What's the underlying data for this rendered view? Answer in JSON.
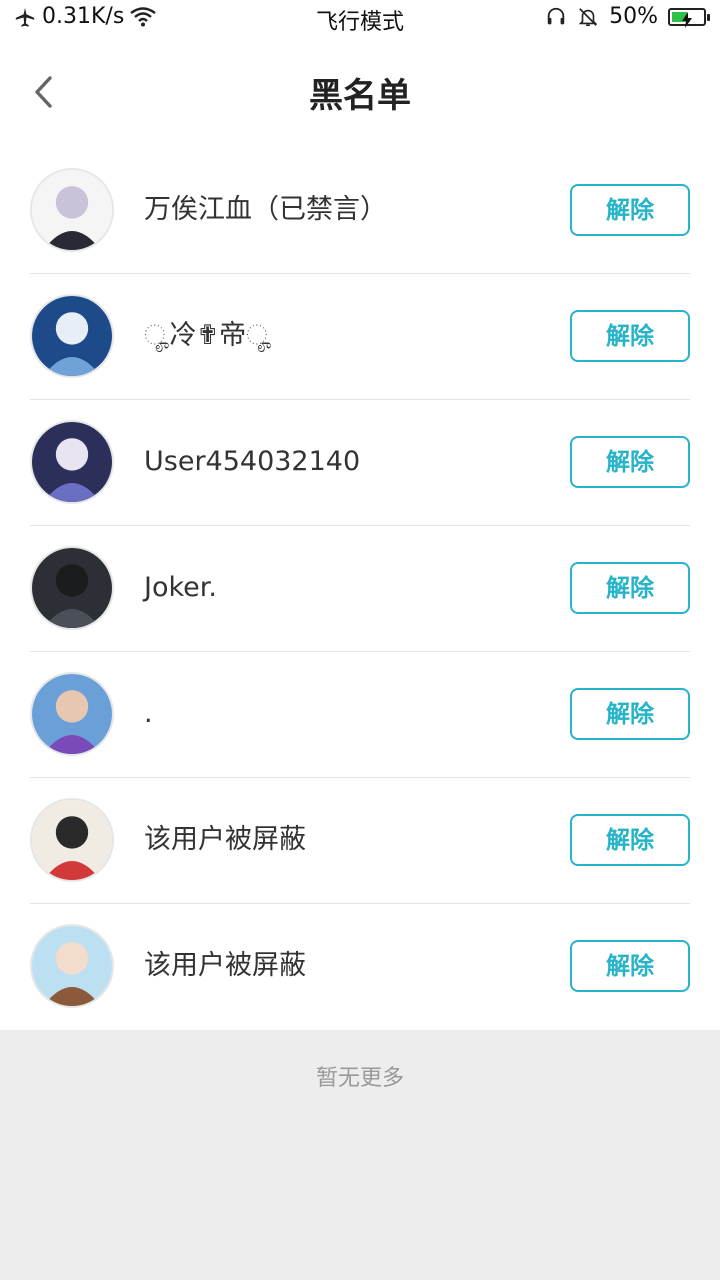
{
  "status_bar": {
    "speed": "0.31K/s",
    "mode": "飞行模式",
    "battery_percent": "50%",
    "battery_level": 0.5,
    "icons": [
      "airplane-icon",
      "wifi-icon",
      "headset-icon",
      "mute-bell-icon",
      "battery-icon"
    ]
  },
  "header": {
    "title": "黑名单",
    "back_icon": "chevron-left-icon"
  },
  "list": {
    "items": [
      {
        "name": "万俟江血（已禁言）",
        "button": "解除",
        "avatar_colors": [
          "#f5f5f5",
          "#2a2a35",
          "#c9c2d8"
        ]
      },
      {
        "name": "ೄ冷✟帝ೄ",
        "button": "解除",
        "avatar_colors": [
          "#1d4b8a",
          "#6fa3d8",
          "#e8eef6"
        ]
      },
      {
        "name": "User454032140",
        "button": "解除",
        "avatar_colors": [
          "#2b2f5a",
          "#6a6fc1",
          "#e8e4f2"
        ]
      },
      {
        "name": "Joker.",
        "button": "解除",
        "avatar_colors": [
          "#2c2f36",
          "#4a4f58",
          "#1a1c20"
        ]
      },
      {
        "name": ".",
        "button": "解除",
        "avatar_colors": [
          "#6a9fd8",
          "#7a4bb8",
          "#e8c7b0"
        ]
      },
      {
        "name": "该用户被屏蔽",
        "button": "解除",
        "avatar_colors": [
          "#f0ebe3",
          "#d23a3a",
          "#2a2a2a"
        ]
      },
      {
        "name": "该用户被屏蔽",
        "button": "解除",
        "avatar_colors": [
          "#bcdff2",
          "#8a5a3a",
          "#f3dccb"
        ]
      }
    ]
  },
  "footer": {
    "text": "暂无更多"
  },
  "colors": {
    "accent": "#27b3c8",
    "background": "#ededed",
    "battery_green": "#2fc24a"
  }
}
